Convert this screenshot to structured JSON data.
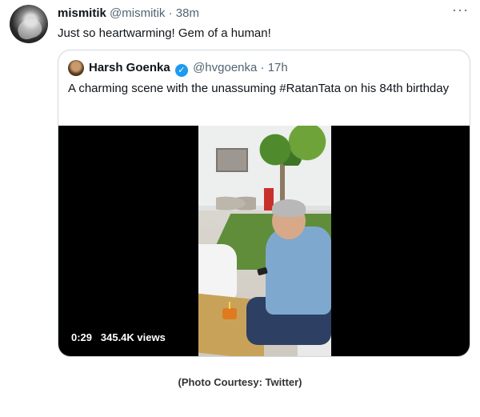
{
  "tweet": {
    "author_name": "mismitik",
    "handle": "@mismitik",
    "time": "38m",
    "text": "Just so heartwarming! Gem of a human!",
    "more_icon": "ellipsis-icon"
  },
  "quote": {
    "author_name": "Harsh Goenka",
    "verified_icon": "verified-badge-icon",
    "handle": "@hvgoenka",
    "time": "17h",
    "text": "A charming scene with the unassuming #RatanTata on his 84th birthday",
    "video": {
      "duration": "0:29",
      "views": "345.4K views"
    }
  },
  "caption": "(Photo Courtesy: Twitter)",
  "colors": {
    "text": "#0f1419",
    "muted": "#536471",
    "verified": "#1d9bf0",
    "border": "#cfd9de"
  }
}
